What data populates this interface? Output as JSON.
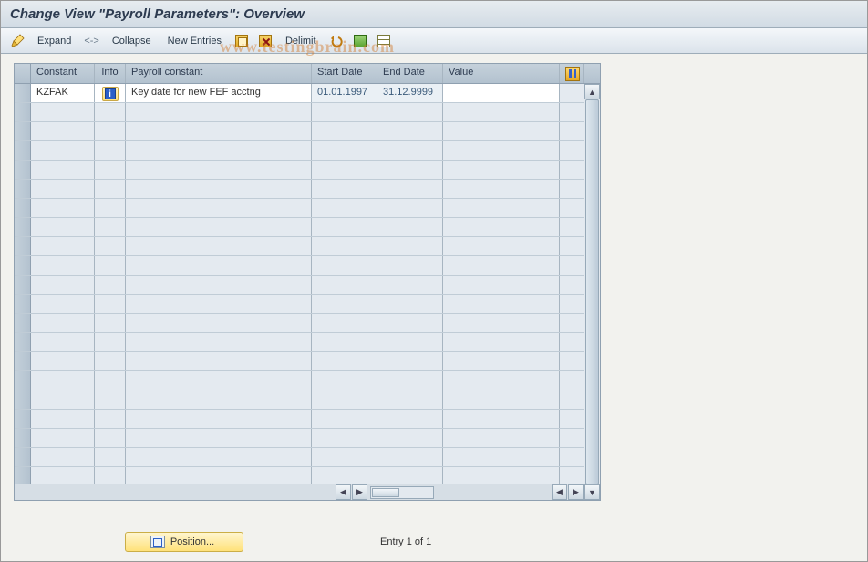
{
  "title": "Change View \"Payroll Parameters\": Overview",
  "toolbar": {
    "expand": "Expand",
    "collapse_sep": "<->",
    "collapse": "Collapse",
    "new_entries": "New Entries",
    "delimit": "Delimit"
  },
  "columns": {
    "constant": "Constant",
    "info": "Info",
    "payroll_constant": "Payroll constant",
    "start_date": "Start Date",
    "end_date": "End Date",
    "value": "Value"
  },
  "rows": [
    {
      "constant": "KZFAK",
      "info": "i",
      "desc": "Key date for new FEF acctng",
      "start_date": "01.01.1997",
      "end_date": "31.12.9999",
      "value": ""
    }
  ],
  "footer": {
    "position_label": "Position...",
    "entry_text": "Entry 1 of 1"
  },
  "watermark": "www.testingbrain.com"
}
